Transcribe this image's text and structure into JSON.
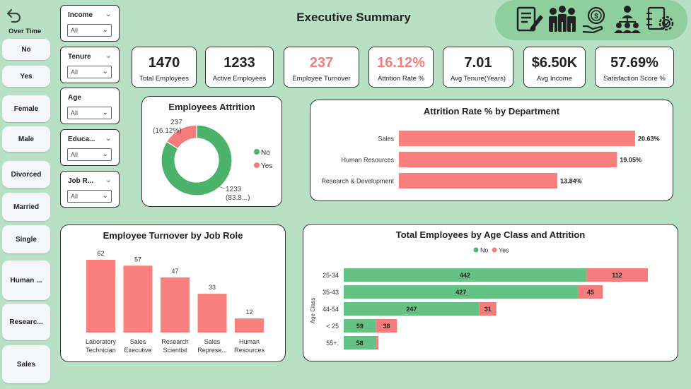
{
  "header": {
    "title": "Executive Summary",
    "back_label": "Over Time"
  },
  "slicers": [
    "No",
    "Yes",
    "Female",
    "Male",
    "Divorced",
    "Married",
    "Single",
    "Human ...",
    "Researc...",
    "Sales"
  ],
  "filters": [
    {
      "title": "Income",
      "value": "All"
    },
    {
      "title": "Tenure",
      "value": "All"
    },
    {
      "title": "Age",
      "value": "All"
    },
    {
      "title": "Educa...",
      "value": "All"
    },
    {
      "title": "Job R...",
      "value": "All"
    }
  ],
  "kpis": [
    {
      "value": "1470",
      "label": "Total Employees"
    },
    {
      "value": "1233",
      "label": "Active Employees"
    },
    {
      "value": "237",
      "label": "Employee Turnover"
    },
    {
      "value": "16.12%",
      "label": "Attrition Rate %"
    },
    {
      "value": "7.01",
      "label": "Avg Tenure(Years)"
    },
    {
      "value": "$6.50K",
      "label": "Avg Income"
    },
    {
      "value": "57.69%",
      "label": "Satisfaction Score %"
    }
  ],
  "nav_icons": [
    "document-edit-icon",
    "team-icon",
    "money-hand-icon",
    "org-chart-icon",
    "analytics-settings-icon"
  ],
  "colors": {
    "no": "#4cb36b",
    "yes": "#f47c7c",
    "bar_red": "#fa7f7f",
    "bar_green": "#66c184",
    "accent_red": "#f36b6b",
    "bg": "#b7e0c4"
  },
  "chart_data": [
    {
      "type": "pie",
      "title": "Employees Attrition",
      "labels": [
        "No",
        "Yes"
      ],
      "values": [
        1233,
        237
      ],
      "data_labels": [
        {
          "count": "1233",
          "pct": "(83.8...)"
        },
        {
          "count": "237",
          "pct": "(16.12%)"
        }
      ],
      "legend": [
        "No",
        "Yes"
      ]
    },
    {
      "type": "bar",
      "title": "Attrition Rate % by Department",
      "categories": [
        "Sales",
        "Human Resources",
        "Research & Development"
      ],
      "values": [
        20.63,
        19.05,
        13.84
      ],
      "value_labels": [
        "20.63%",
        "19.05%",
        "13.84%"
      ],
      "xlim": [
        0,
        21
      ]
    },
    {
      "type": "bar",
      "title": "Employee Turnover by Job Role",
      "categories": [
        [
          "Laboratory",
          "Technician"
        ],
        [
          "Sales",
          "Executive"
        ],
        [
          "Research",
          "Scientist"
        ],
        [
          "Sales",
          "Represe..."
        ],
        [
          "Human",
          "Resources"
        ]
      ],
      "values": [
        62,
        57,
        47,
        33,
        12
      ],
      "ylim": [
        0,
        62
      ]
    },
    {
      "type": "bar",
      "title": "Total Employees by Age Class and Attrition",
      "ylabel": "Age Class",
      "legend": [
        "No",
        "Yes"
      ],
      "categories": [
        "25-34",
        "35-43",
        "44-54",
        "< 25",
        "55+."
      ],
      "series": [
        {
          "name": "No",
          "values": [
            442,
            427,
            247,
            59,
            58
          ]
        },
        {
          "name": "Yes",
          "values": [
            112,
            45,
            31,
            38,
            5
          ]
        }
      ],
      "yes_labels": [
        "112",
        "45",
        "31",
        "38",
        ""
      ],
      "xlim": [
        0,
        554
      ]
    }
  ]
}
